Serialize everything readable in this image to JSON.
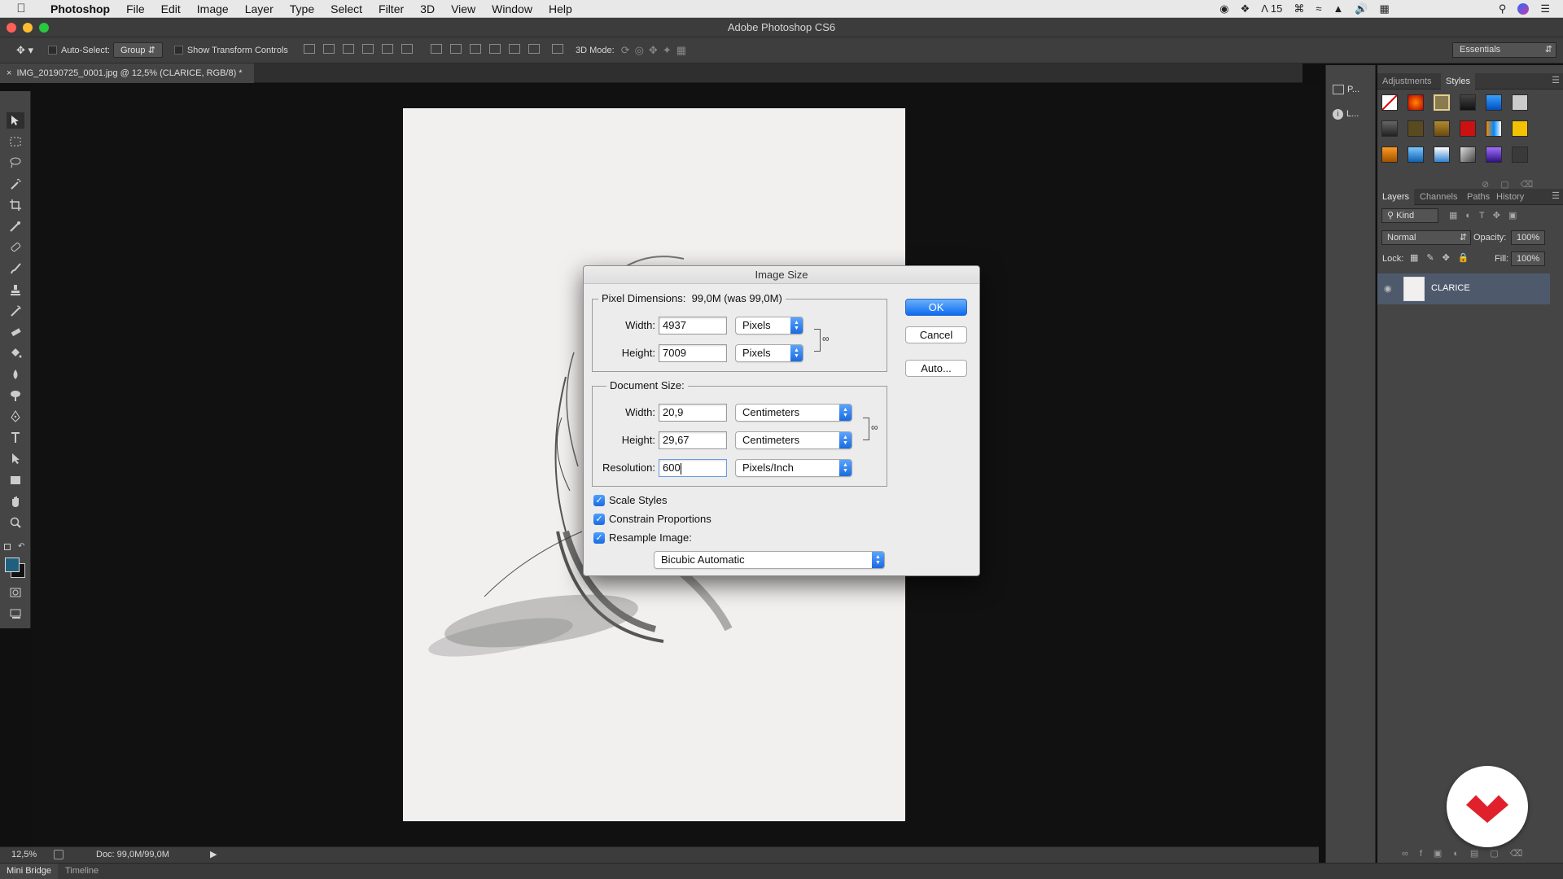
{
  "menubar": {
    "app": "Photoshop",
    "items": [
      "File",
      "Edit",
      "Image",
      "Layer",
      "Type",
      "Select",
      "Filter",
      "3D",
      "View",
      "Window",
      "Help"
    ],
    "status_text": "15"
  },
  "window": {
    "title": "Adobe Photoshop CS6"
  },
  "options": {
    "auto_select_label": "Auto-Select:",
    "auto_select_value": "Group",
    "transform_label": "Show Transform Controls",
    "mode_3d_label": "3D Mode:",
    "workspace": "Essentials"
  },
  "document": {
    "tab_title": "IMG_20190725_0001.jpg @ 12,5% (CLARICE, RGB/8) *"
  },
  "status": {
    "zoom": "12,5%",
    "doc": "Doc: 99,0M/99,0M"
  },
  "bottom_tabs": [
    "Mini Bridge",
    "Timeline"
  ],
  "dialog": {
    "title": "Image Size",
    "pixel_dimensions_label": "Pixel Dimensions:",
    "pixel_dimensions_value": "99,0M (was 99,0M)",
    "width_label": "Width:",
    "height_label": "Height:",
    "pixel_width": "4937",
    "pixel_height": "7009",
    "pixel_unit_w": "Pixels",
    "pixel_unit_h": "Pixels",
    "document_size_label": "Document Size:",
    "doc_width": "20,9",
    "doc_height": "29,67",
    "doc_unit_w": "Centimeters",
    "doc_unit_h": "Centimeters",
    "resolution_label": "Resolution:",
    "resolution": "600",
    "resolution_unit": "Pixels/Inch",
    "ok": "OK",
    "cancel": "Cancel",
    "auto": "Auto...",
    "scale_styles": "Scale Styles",
    "constrain": "Constrain Proportions",
    "resample": "Resample Image:",
    "resample_method": "Bicubic Automatic"
  },
  "panels": {
    "top_strip": [
      "P...",
      "L..."
    ],
    "adj_tabs": [
      "Adjustments",
      "Styles"
    ],
    "layer_tabs": [
      "Layers",
      "Channels",
      "Paths",
      "History"
    ],
    "kind": "Kind",
    "blend": "Normal",
    "opacity_label": "Opacity:",
    "opacity": "100%",
    "lock_label": "Lock:",
    "fill_label": "Fill:",
    "fill": "100%",
    "layer_name": "CLARICE"
  },
  "colors": {
    "accent": "#1a6be0",
    "foreground": "#1f5f80",
    "logo": "#e0202a"
  }
}
